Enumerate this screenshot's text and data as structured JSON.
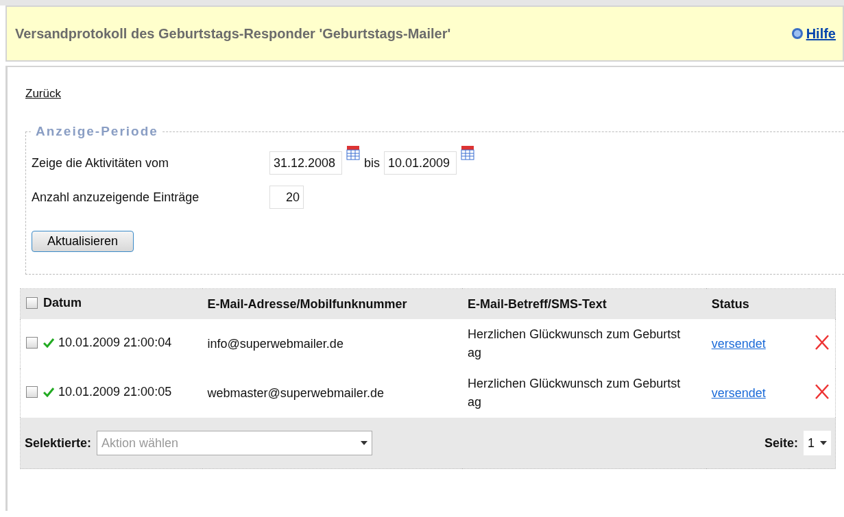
{
  "header": {
    "title": "Versandprotokoll des Geburtstags-Responder 'Geburtstags-Mailer'",
    "help_link": "Hilfe"
  },
  "back_link": "Zurück",
  "period": {
    "legend": "Anzeige-Periode",
    "from_label": "Zeige die Aktivitäten vom",
    "from_value": "31.12.2008",
    "between": "bis",
    "to_value": "10.01.2009",
    "count_label": "Anzahl anzuzeigende Einträge",
    "count_value": "20",
    "button": "Aktualisieren"
  },
  "table": {
    "select_all_checked": false,
    "columns": [
      "Datum",
      "E-Mail-Adresse/Mobilfunknummer",
      "E-Mail-Betreff/SMS-Text",
      "Status"
    ],
    "rows": [
      {
        "checked": false,
        "date": "10.01.2009 21:00:04",
        "address": "info@superwebmailer.de",
        "subject": "Herzlichen Glückwunsch zum Geburtstag",
        "status": "versendet"
      },
      {
        "checked": false,
        "date": "10.01.2009 21:00:05",
        "address": "webmaster@superwebmailer.de",
        "subject": "Herzlichen Glückwunsch zum Geburtstag",
        "status": "versendet"
      }
    ]
  },
  "footer": {
    "selected_label": "Selektierte:",
    "action_placeholder": "Aktion wählen",
    "page_label": "Seite:",
    "page_value": "1"
  }
}
